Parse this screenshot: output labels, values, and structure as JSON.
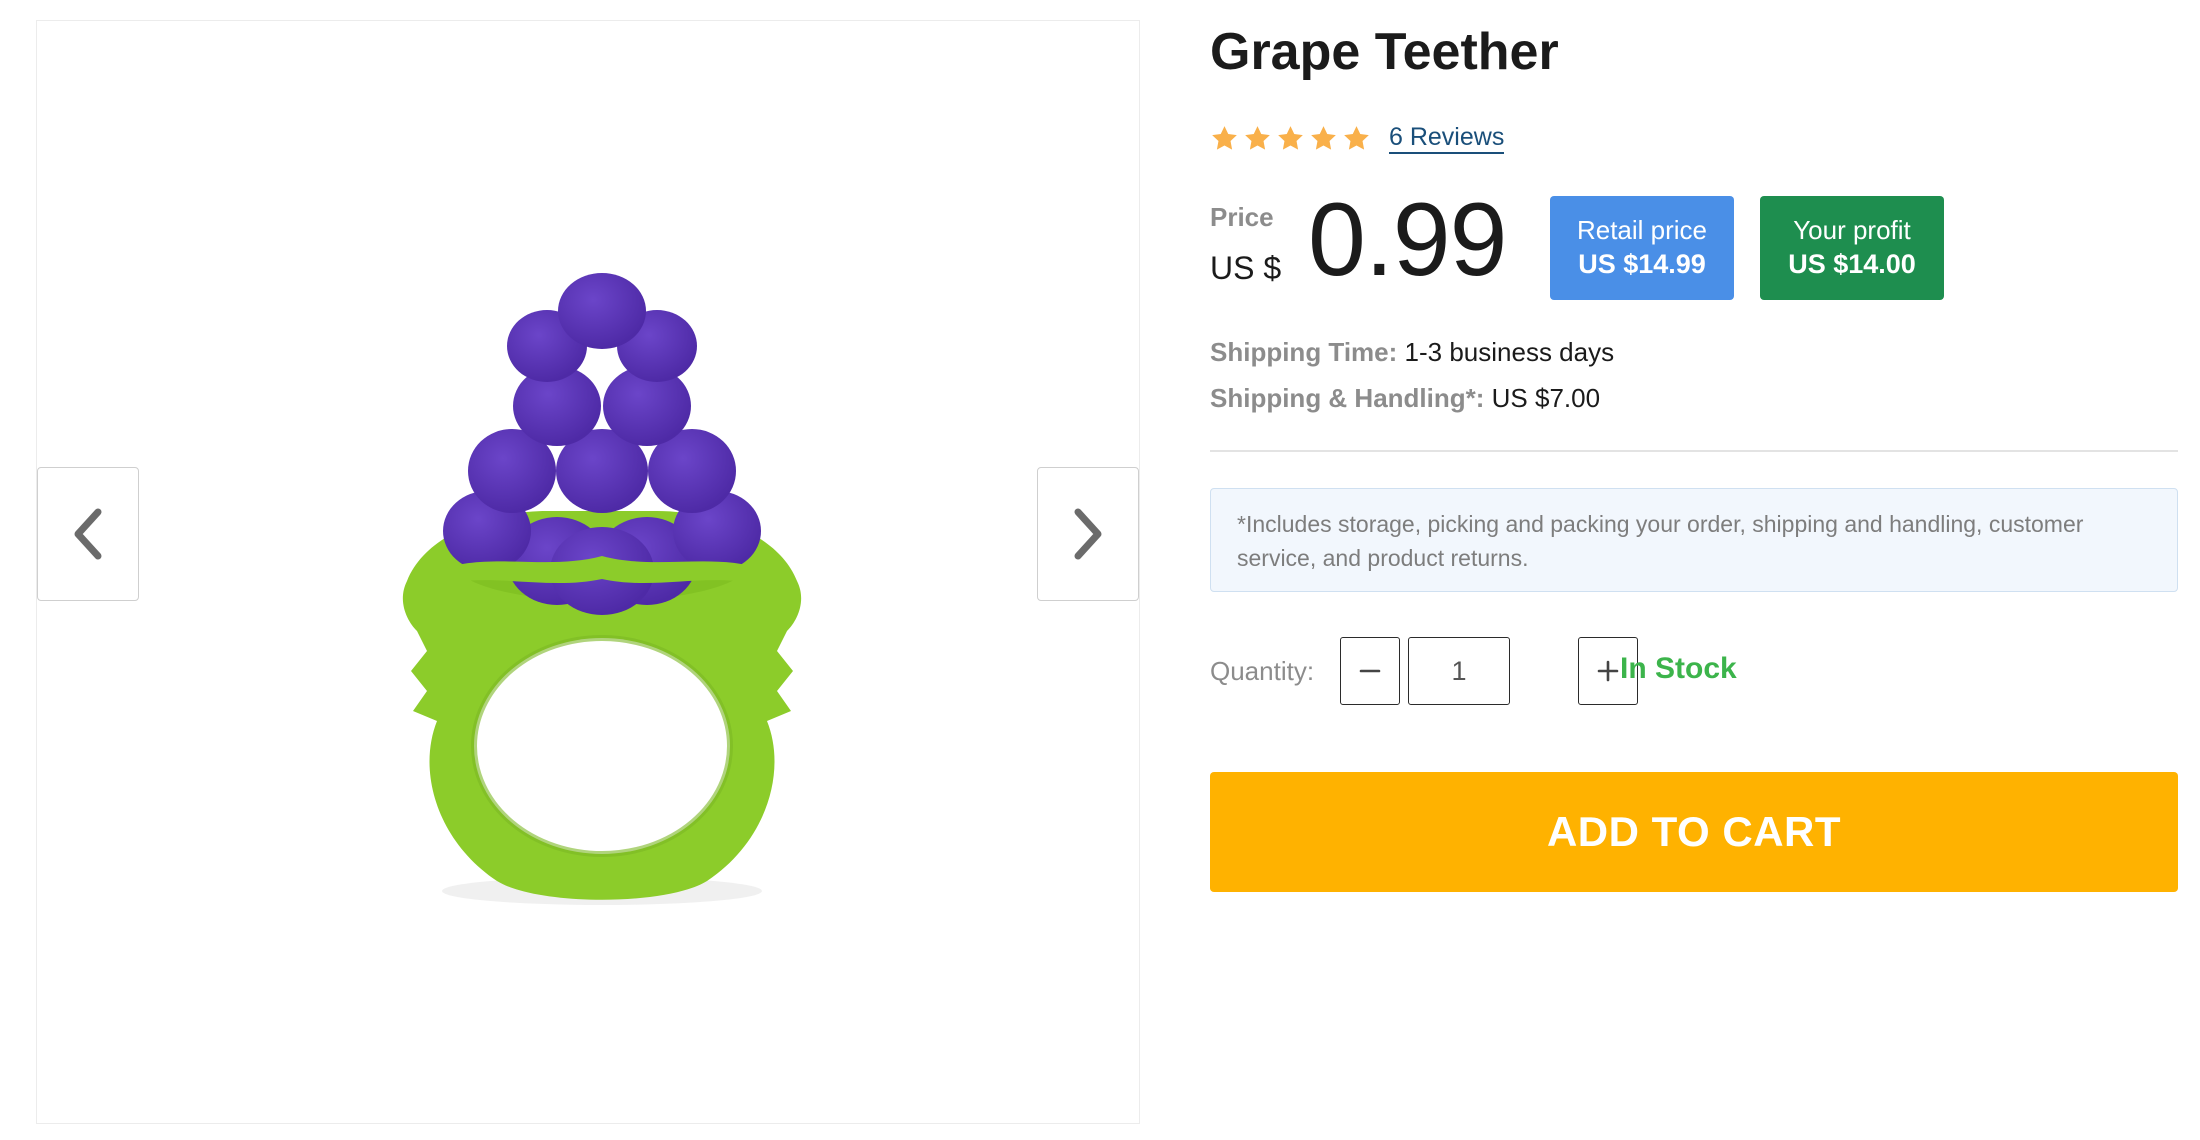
{
  "product": {
    "title": "Grape Teether",
    "image_alt": "Grape Teether",
    "rating": 5,
    "rating_max": 5,
    "reviews_label": "6 Reviews"
  },
  "pricing": {
    "price_label": "Price",
    "currency": "US $",
    "price": "0.99",
    "retail_label": "Retail price",
    "retail_value": "US $14.99",
    "profit_label": "Your profit",
    "profit_value": "US $14.00"
  },
  "shipping": {
    "time_label": "Shipping Time:",
    "time_value": "1-3 business days",
    "handling_label": "Shipping & Handling*:",
    "handling_value": "US $7.00",
    "note": "*Includes storage, picking and packing your order, shipping and handling, customer service, and product returns."
  },
  "quantity": {
    "label": "Quantity:",
    "value": "1",
    "stock_status": "In Stock"
  },
  "cart": {
    "button_label": "ADD TO CART"
  },
  "colors": {
    "star": "#f9b04a",
    "retail_badge": "#4a8fe7",
    "profit_badge": "#1e8e4f",
    "in_stock": "#3cb44b",
    "add_to_cart": "#ffb200",
    "grape": "#5b34b8",
    "teether_ring": "#8ccc2a"
  },
  "icons": {
    "prev": "chevron-left-icon",
    "next": "chevron-right-icon",
    "minus": "minus-icon",
    "plus": "plus-icon",
    "star": "star-icon"
  }
}
